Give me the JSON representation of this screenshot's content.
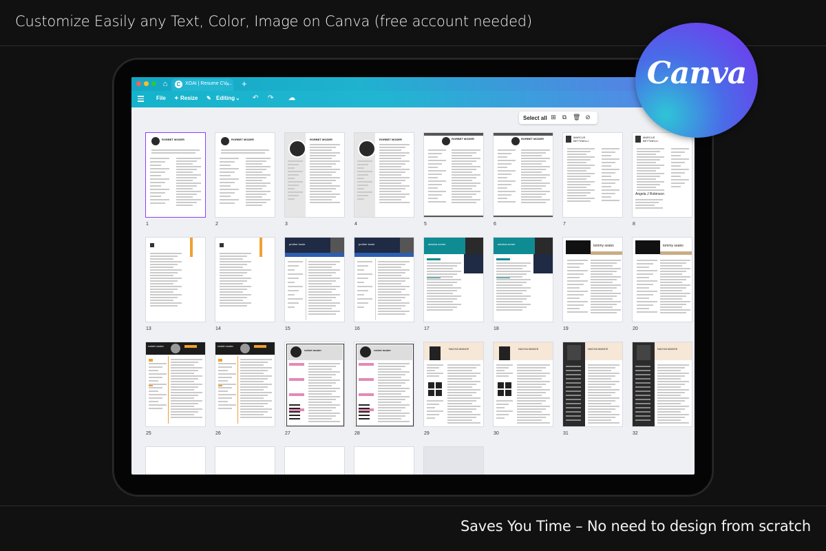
{
  "header": {
    "title": "Customize Easily any Text, Color, Image on Canva (free account needed)"
  },
  "footer": {
    "text": "Saves You Time – No need to design from scratch"
  },
  "badge": {
    "logo_text": "Canva"
  },
  "browser": {
    "tab_label": "XOAI | Resume CV ...",
    "tab_glyph": "C",
    "new_tab": "+",
    "close": "×",
    "home_icon": "⌂"
  },
  "toolbar": {
    "file": "File",
    "resize": "Resize",
    "editing": "Editing",
    "undo": "↶",
    "redo": "↷",
    "sync": "☁"
  },
  "selection_bar": {
    "select_all": "Select all"
  },
  "thumb_texts": {
    "rorbet_moder": "RORBET MODER",
    "rorbet_moder_lower": "rorbet moder",
    "marcus": "MARCUS BETTINELLI",
    "angela": "Angela J Robinson",
    "prother": "prother koole",
    "arkaina": "arkaina somer",
    "tommy": "tommy seako",
    "nacha": "NACHA MANCE"
  },
  "pages": [
    {
      "n": "1",
      "style": "a",
      "sel": true
    },
    {
      "n": "2",
      "style": "a"
    },
    {
      "n": "3",
      "style": "b"
    },
    {
      "n": "4",
      "style": "b"
    },
    {
      "n": "5",
      "style": "c"
    },
    {
      "n": "6",
      "style": "c"
    },
    {
      "n": "7",
      "style": "d"
    },
    {
      "n": "8",
      "style": "e"
    },
    {
      "n": "13",
      "style": "f"
    },
    {
      "n": "14",
      "style": "f"
    },
    {
      "n": "15",
      "style": "g"
    },
    {
      "n": "16",
      "style": "g"
    },
    {
      "n": "17",
      "style": "h"
    },
    {
      "n": "18",
      "style": "h"
    },
    {
      "n": "19",
      "style": "i"
    },
    {
      "n": "20",
      "style": "i"
    },
    {
      "n": "25",
      "style": "j"
    },
    {
      "n": "26",
      "style": "j"
    },
    {
      "n": "27",
      "style": "k"
    },
    {
      "n": "28",
      "style": "k"
    },
    {
      "n": "29",
      "style": "l"
    },
    {
      "n": "30",
      "style": "l"
    },
    {
      "n": "31",
      "style": "m"
    },
    {
      "n": "32",
      "style": "m"
    },
    {
      "n": "",
      "style": "blank"
    },
    {
      "n": "",
      "style": "blank"
    },
    {
      "n": "",
      "style": "blank"
    },
    {
      "n": "",
      "style": "blank"
    },
    {
      "n": "",
      "style": "gray"
    }
  ],
  "colors": {
    "accent_purple": "#8b3dff",
    "toolbar_teal": "#1fb2cf",
    "orange": "#f0a030",
    "navy": "#1f2a44",
    "teal_dark": "#0f8c93",
    "beige": "#c9ad85",
    "pink": "#e28ab6"
  }
}
